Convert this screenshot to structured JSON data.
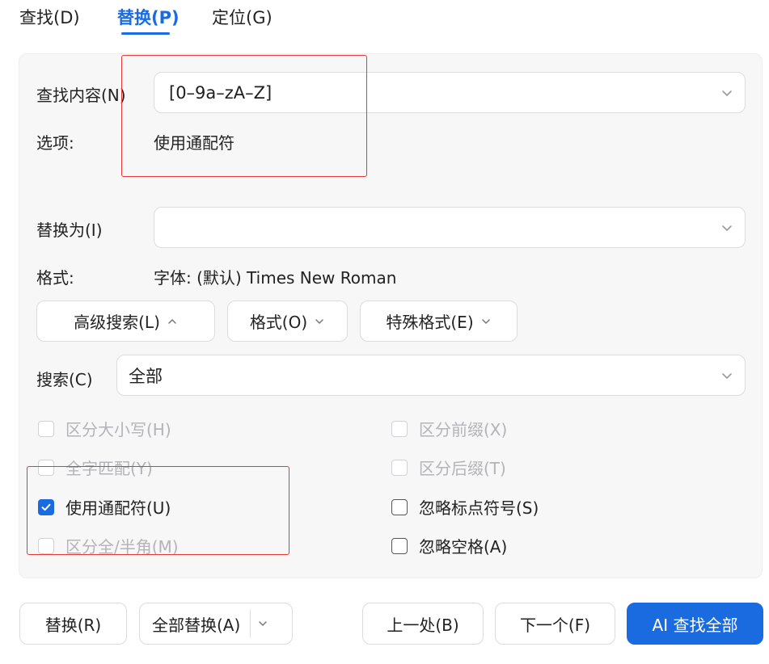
{
  "tabs": [
    {
      "label": "查找(D)"
    },
    {
      "label": "替换(P)"
    },
    {
      "label": "定位(G)"
    }
  ],
  "find": {
    "label": "查找内容(N)",
    "value": "[0–9a–zA–Z]",
    "options_label": "选项:",
    "options_value": "使用通配符"
  },
  "replace": {
    "label": "替换为(I)",
    "value": "",
    "format_label": "格式:",
    "format_value": "字体: (默认) Times New Roman"
  },
  "buttons_row": {
    "advanced": "高级搜索(L)",
    "format": "格式(O)",
    "special": "特殊格式(E)"
  },
  "search": {
    "label": "搜索(C)",
    "value": "全部"
  },
  "options": {
    "case": "区分大小写(H)",
    "prefix": "区分前缀(X)",
    "whole": "全字匹配(Y)",
    "suffix": "区分后缀(T)",
    "wildcard": "使用通配符(U)",
    "ignore_punct": "忽略标点符号(S)",
    "width": "区分全/半角(M)",
    "ignore_space": "忽略空格(A)"
  },
  "footer": {
    "replace": "替换(R)",
    "replace_all": "全部替换(A)",
    "prev": "上一处(B)",
    "next": "下一个(F)",
    "ai_find_all": "AI 查找全部"
  },
  "colors": {
    "accent": "#1a6be0",
    "annotation": "#e53935"
  }
}
